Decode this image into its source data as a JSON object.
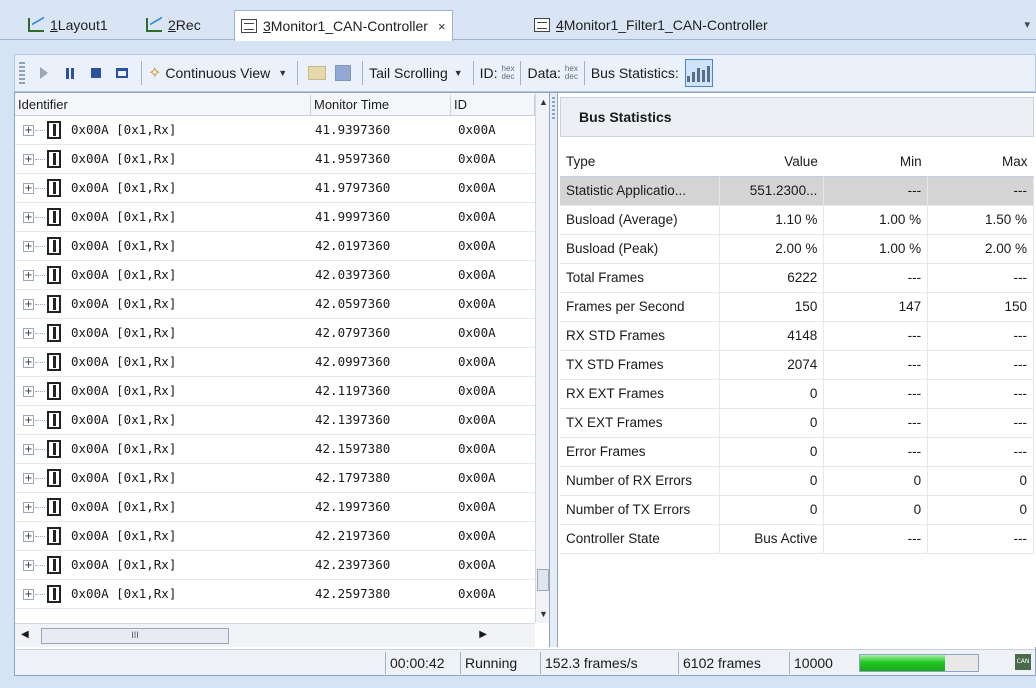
{
  "tabs": [
    {
      "num": "1",
      "label": " Layout1"
    },
    {
      "num": "2",
      "label": " Rec"
    },
    {
      "num": "3",
      "label": " Monitor1_CAN-Controller",
      "close": "×"
    },
    {
      "num": "4",
      "label": " Monitor1_Filter1_CAN-Controller"
    }
  ],
  "tab_overflow": "▾",
  "toolbar": {
    "view_label": "Continuous View",
    "tail_label": "Tail Scrolling",
    "id_label": "ID:",
    "data_label": "Data:",
    "fmt_top": "hex",
    "fmt_bottom": "dec",
    "bus_stats_label": "Bus Statistics:"
  },
  "list": {
    "columns": [
      "Identifier",
      "Monitor Time",
      "ID"
    ],
    "rows": [
      {
        "id": "0x00A [0x1,Rx]",
        "time": "41.9397360",
        "idc": "0x00A"
      },
      {
        "id": "0x00A [0x1,Rx]",
        "time": "41.9597360",
        "idc": "0x00A"
      },
      {
        "id": "0x00A [0x1,Rx]",
        "time": "41.9797360",
        "idc": "0x00A"
      },
      {
        "id": "0x00A [0x1,Rx]",
        "time": "41.9997360",
        "idc": "0x00A"
      },
      {
        "id": "0x00A [0x1,Rx]",
        "time": "42.0197360",
        "idc": "0x00A"
      },
      {
        "id": "0x00A [0x1,Rx]",
        "time": "42.0397360",
        "idc": "0x00A"
      },
      {
        "id": "0x00A [0x1,Rx]",
        "time": "42.0597360",
        "idc": "0x00A"
      },
      {
        "id": "0x00A [0x1,Rx]",
        "time": "42.0797360",
        "idc": "0x00A"
      },
      {
        "id": "0x00A [0x1,Rx]",
        "time": "42.0997360",
        "idc": "0x00A"
      },
      {
        "id": "0x00A [0x1,Rx]",
        "time": "42.1197360",
        "idc": "0x00A"
      },
      {
        "id": "0x00A [0x1,Rx]",
        "time": "42.1397360",
        "idc": "0x00A"
      },
      {
        "id": "0x00A [0x1,Rx]",
        "time": "42.1597380",
        "idc": "0x00A"
      },
      {
        "id": "0x00A [0x1,Rx]",
        "time": "42.1797380",
        "idc": "0x00A"
      },
      {
        "id": "0x00A [0x1,Rx]",
        "time": "42.1997360",
        "idc": "0x00A"
      },
      {
        "id": "0x00A [0x1,Rx]",
        "time": "42.2197360",
        "idc": "0x00A"
      },
      {
        "id": "0x00A [0x1,Rx]",
        "time": "42.2397360",
        "idc": "0x00A"
      },
      {
        "id": "0x00A [0x1,Rx]",
        "time": "42.2597380",
        "idc": "0x00A"
      }
    ],
    "scroll_grip": "III"
  },
  "stats": {
    "title": "Bus Statistics",
    "columns": [
      "Type",
      "Value",
      "Min",
      "Max"
    ],
    "rows": [
      [
        "Statistic Applicatio...",
        "551.2300...",
        "---",
        "---"
      ],
      [
        "Busload (Average)",
        "1.10 %",
        "1.00 %",
        "1.50 %"
      ],
      [
        "Busload (Peak)",
        "2.00 %",
        "1.00 %",
        "2.00 %"
      ],
      [
        "Total Frames",
        "6222",
        "---",
        "---"
      ],
      [
        "Frames per Second",
        "150",
        "147",
        "150"
      ],
      [
        "RX STD Frames",
        "4148",
        "---",
        "---"
      ],
      [
        "TX STD Frames",
        "2074",
        "---",
        "---"
      ],
      [
        "RX EXT Frames",
        "0",
        "---",
        "---"
      ],
      [
        "TX EXT Frames",
        "0",
        "---",
        "---"
      ],
      [
        "Error Frames",
        "0",
        "---",
        "---"
      ],
      [
        "Number of RX Errors",
        "0",
        "0",
        "0"
      ],
      [
        "Number of TX Errors",
        "0",
        "0",
        "0"
      ],
      [
        "Controller State",
        "Bus Active",
        "---",
        "---"
      ]
    ]
  },
  "status": {
    "elapsed": "00:00:42",
    "state": "Running",
    "rate": "152.3 frames/s",
    "frames": "6102 frames",
    "buffer": "10000",
    "buffer_fill": 0.72,
    "can_logo": "CAN"
  }
}
